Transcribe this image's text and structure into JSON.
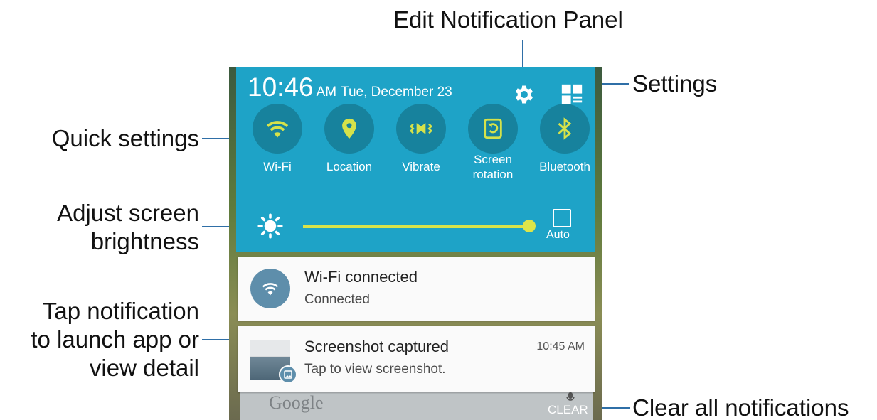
{
  "callouts": {
    "edit_panel": "Edit Notification Panel",
    "settings": "Settings",
    "quick_settings": "Quick settings",
    "brightness_line1": "Adjust screen",
    "brightness_line2": "brightness",
    "tap_line1": "Tap notification",
    "tap_line2": "to launch app or",
    "tap_line3": "view detail",
    "clear_all": "Clear all notifications"
  },
  "status": {
    "time": "10:46",
    "ampm": "AM",
    "date": "Tue, December 23"
  },
  "quick_settings": [
    {
      "label": "Wi-Fi",
      "icon": "wifi-icon",
      "active": true
    },
    {
      "label": "Location",
      "icon": "location-icon",
      "active": true
    },
    {
      "label": "Vibrate",
      "icon": "vibrate-icon",
      "active": true
    },
    {
      "label": "Screen\nrotation",
      "icon": "screen-rotation-icon",
      "active": true
    },
    {
      "label": "Bluetooth",
      "icon": "bluetooth-icon",
      "active": true
    }
  ],
  "brightness": {
    "level": 1.0,
    "auto_label": "Auto",
    "auto_checked": false
  },
  "notifications": [
    {
      "title": "Wi-Fi connected",
      "subtitle": "Connected",
      "icon": "wifi-icon"
    },
    {
      "title": "Screenshot captured",
      "subtitle": "Tap to view screenshot.",
      "time": "10:45 AM",
      "icon": "screenshot-thumbnail"
    }
  ],
  "background": {
    "search_text": "Google"
  },
  "clear_label": "CLEAR",
  "colors": {
    "panel": "#1ea3c7",
    "qs_circle": "#17829d",
    "qs_icon_active": "#d6e24a",
    "slider": "#d9e34a",
    "leader": "#2f6fa7"
  }
}
